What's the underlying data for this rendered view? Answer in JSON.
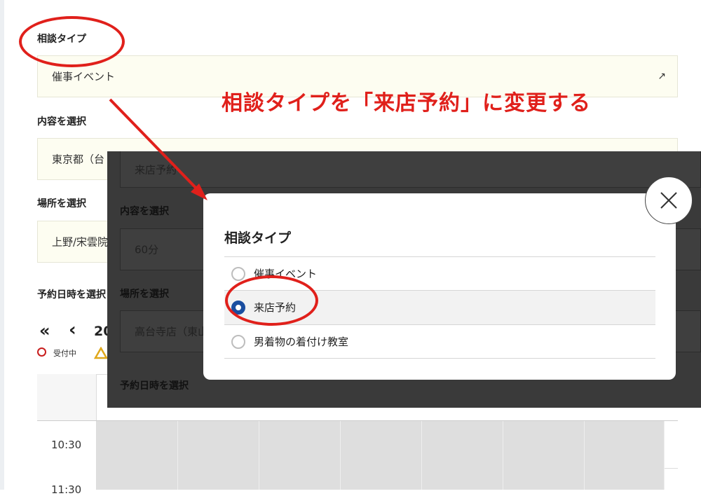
{
  "form": {
    "consult_type_label": "相談タイプ",
    "consult_type_value": "催事イベント",
    "content_label": "内容を選択",
    "content_value": "東京都（台",
    "place_label": "場所を選択",
    "place_value": "上野/宋雲院",
    "datetime_label": "予約日時を選択",
    "nav_prev_prev": "«",
    "nav_prev": "‹",
    "year_partial": "20",
    "legend_open": "受付中"
  },
  "calendar": {
    "times": [
      "10:30",
      "11:30"
    ]
  },
  "dark_panel": {
    "consult_value": "来店予約",
    "content_label": "内容を選択",
    "content_value": "60分",
    "place_label": "場所を選択",
    "place_value": "高台寺店（東山",
    "datetime_label": "予約日時を選択"
  },
  "modal": {
    "title": "相談タイプ",
    "options": [
      {
        "label": "催事イベント",
        "selected": false
      },
      {
        "label": "来店予約",
        "selected": true
      },
      {
        "label": "男着物の着付け教室",
        "selected": false
      }
    ],
    "close_icon": "close-icon"
  },
  "annotation": {
    "text": "相談タイプを「来店予約」に変更する",
    "color": "#e0201b"
  }
}
